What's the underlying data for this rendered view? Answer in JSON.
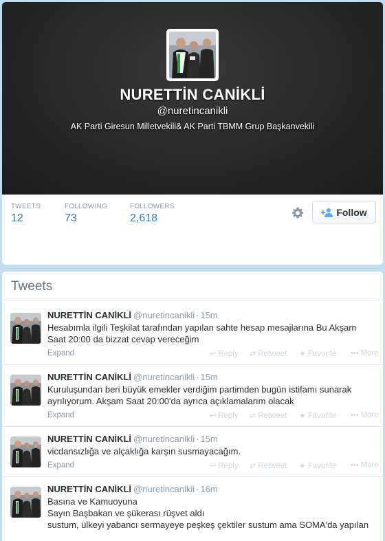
{
  "profile": {
    "name": "NURETTİN CANİKLİ",
    "handle": "@nuretincanikli",
    "bio": "AK Parti Giresun Milletvekili& AK Parti TBMM Grup Başkanvekili",
    "avatar_icon": "profile-photo"
  },
  "stats": [
    {
      "label": "TWEETS",
      "value": "12"
    },
    {
      "label": "FOLLOWING",
      "value": "73"
    },
    {
      "label": "FOLLOWERS",
      "value": "2,618"
    }
  ],
  "actions": {
    "settings_icon": "gear-icon",
    "follow_label": "Follow",
    "follow_icon": "add-user-icon"
  },
  "tweets_section": {
    "title": "Tweets"
  },
  "tweet_actions": {
    "reply": "Reply",
    "retweet": "Retweet",
    "favorite": "Favorite",
    "more": "More"
  },
  "tweets": [
    {
      "name": "NURETTİN CANİKLİ",
      "handle": "@nuretincanikli",
      "time": "15m",
      "lines": [
        "Hesabımla ilgili Teşkilat tarafından yapılan sahte hesap mesajlarına Bu Akşam",
        "Saat 20:00 da bizzat cevap vereceğim"
      ],
      "expand": "Expand"
    },
    {
      "name": "NURETTİN CANİKLİ",
      "handle": "@nuretincanikli",
      "time": "15m",
      "lines": [
        "Kuruluşundan beri büyük emekler verdiğim partimden bugün istifamı sunarak",
        "ayrılıyorum. Akşam Saat 20:00'da ayrıca açıklamalarım olacak"
      ],
      "expand": "Expand"
    },
    {
      "name": "NURETTİN CANİKLİ",
      "handle": "@nuretincanikli",
      "time": "15m",
      "lines": [
        "vicdansızlığa ve alçaklığa karşın susmayacağım."
      ],
      "expand": "Expand"
    },
    {
      "name": "NURETTİN CANİKLİ",
      "handle": "@nuretincanikli",
      "time": "16m",
      "lines": [
        "Basına ve Kamuoyuna",
        "Sayın Başbakan ve şükerası rüşvet aldı",
        "sustum, ülkeyi yabancı sermayeye peşkeş çektiler sustum ama SOMA'da yapılan"
      ],
      "expand": ""
    }
  ]
}
